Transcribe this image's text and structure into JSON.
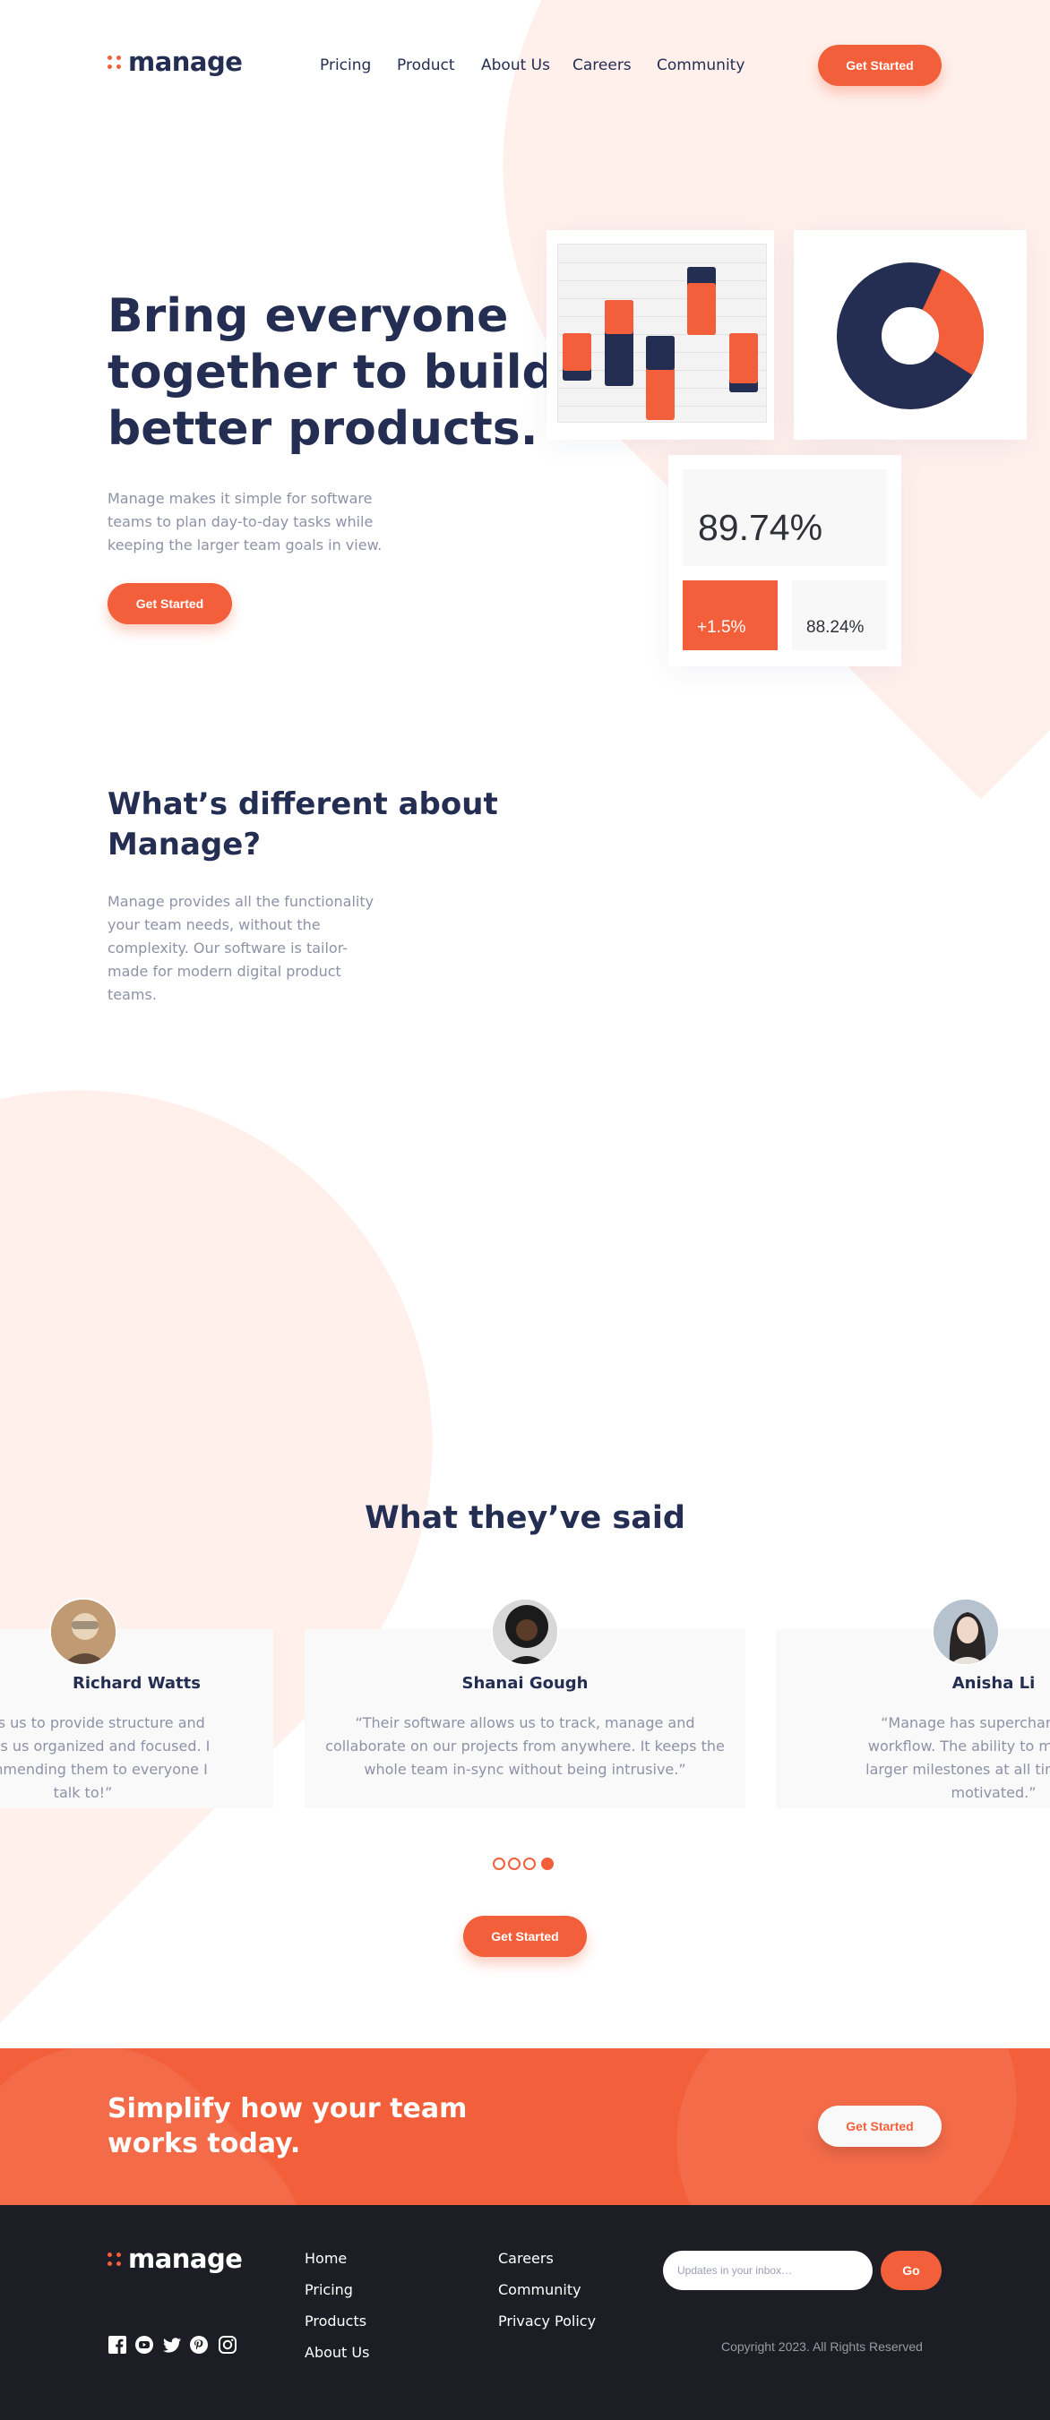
{
  "header": {
    "logo_text": "manage",
    "nav": [
      "Pricing",
      "Product",
      "About Us",
      "Careers",
      "Community"
    ],
    "cta_label": "Get Started"
  },
  "hero": {
    "title_line1": "Bring everyone",
    "title_line2": "together to build",
    "title_line3": "better products.",
    "description_line1": "Manage makes it simple for software",
    "description_line2": "teams to plan day-to-day tasks while",
    "description_line3": "keeping the larger team goals in view.",
    "cta_label": "Get Started",
    "stats": {
      "big_value": "89.74%",
      "change_value": "+1.5%",
      "small_value": "88.24%"
    },
    "donut_fraction": 0.27
  },
  "different": {
    "title_line1": "What’s different about",
    "title_line2": "Manage?",
    "description_line1": "Manage provides all the functionality",
    "description_line2": "your team needs, without the",
    "description_line3": "complexity. Our software is tailor-",
    "description_line4": "made for modern digital product",
    "description_line5": "teams."
  },
  "testimonials": {
    "title": "What they’ve said",
    "items": [
      {
        "name": "Richard Watts",
        "quote_line1": "allows us to provide structure and",
        "quote_line2": "t keeps us organized and focused. I",
        "quote_line3": "recommending them to everyone I",
        "quote_line4": "talk to!”"
      },
      {
        "name": "Shanai Gough",
        "quote_line1": "“Their software allows us to track, manage and",
        "quote_line2": "collaborate on our projects from anywhere. It keeps the",
        "quote_line3": "whole team in-sync without being intrusive.”"
      },
      {
        "name": "Anisha Li",
        "quote_line1": "“Manage has supercharged our",
        "quote_line2": "workflow. The ability to maintain vi",
        "quote_line3": "larger milestones at all times keeps",
        "quote_line4": "motivated.”"
      }
    ],
    "active_dot": 3,
    "dot_count": 4,
    "cta_label": "Get Started"
  },
  "cta_band": {
    "title_line1": "Simplify how your team",
    "title_line2": "works today.",
    "cta_label": "Get Started"
  },
  "footer": {
    "logo_text": "manage",
    "col1": [
      "Home",
      "Pricing",
      "Products",
      "About Us"
    ],
    "col2": [
      "Careers",
      "Community",
      "Privacy Policy"
    ],
    "newsletter_placeholder": "Updates in your inbox…",
    "go_label": "Go",
    "copyright": "Copyright 2023. All Rights Reserved",
    "social_icons": [
      "facebook-icon",
      "youtube-icon",
      "twitter-icon",
      "pinterest-icon",
      "instagram-icon"
    ]
  },
  "colors": {
    "accent": "#f25f3a",
    "navy": "#242d52",
    "pale_accent": "#fff0ec",
    "footer_bg": "#1d1e25"
  }
}
